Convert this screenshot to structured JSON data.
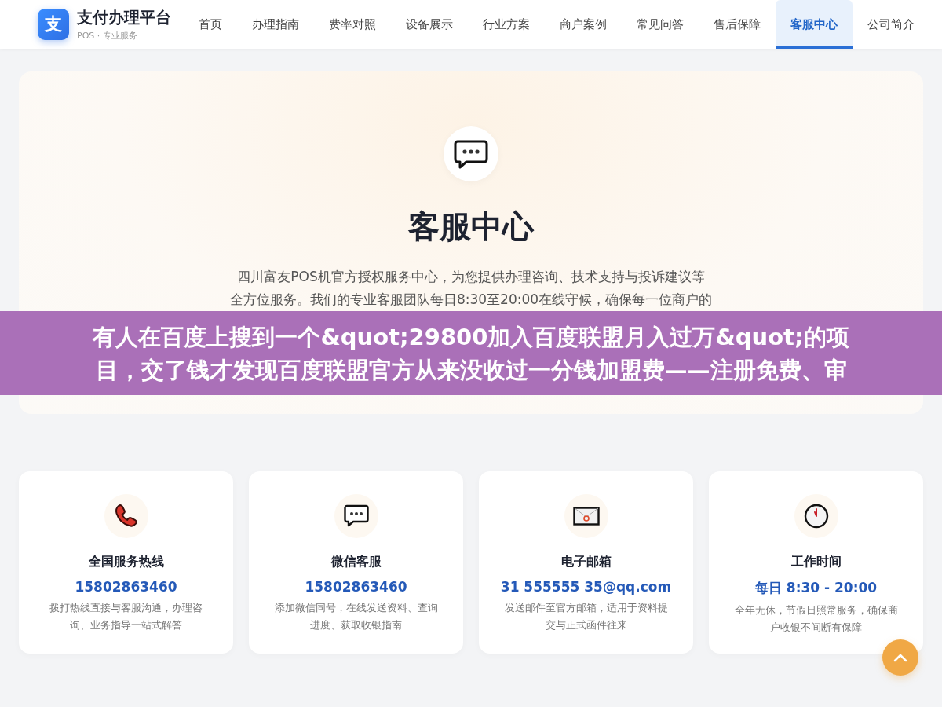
{
  "header": {
    "logo_mark": "支",
    "title": "支付办理平台",
    "subtitle": "POS · 专业服务"
  },
  "nav": [
    {
      "label": "首页",
      "selected": false
    },
    {
      "label": "办理指南",
      "selected": false
    },
    {
      "label": "费率对照",
      "selected": false
    },
    {
      "label": "设备展示",
      "selected": false
    },
    {
      "label": "行业方案",
      "selected": false
    },
    {
      "label": "商户案例",
      "selected": false
    },
    {
      "label": "常见问答",
      "selected": false
    },
    {
      "label": "售后保障",
      "selected": false
    },
    {
      "label": "客服中心",
      "selected": true
    },
    {
      "label": "公司简介",
      "selected": false
    }
  ],
  "hero": {
    "title": "客服中心",
    "description_lines": [
      "四川富友POS机官方授权服务中心，为您提供办理咨询、技术支持与投诉建议等",
      "全方位服务。我们的专业客服团队每日8:30至20:00在线守候，确保每一位商户的"
    ]
  },
  "cards": [
    {
      "kind": "phone",
      "title": "全国服务热线",
      "value": "15802863460",
      "description": "拨打热线直接与客服沟通，办理咨询、业务指导一站式解答"
    },
    {
      "kind": "chat",
      "title": "微信客服",
      "value": "15802863460",
      "description": "添加微信同号，在线发送资料、查询进度、获取收银指南"
    },
    {
      "kind": "mail",
      "title": "电子邮箱",
      "value": "31 555555 35@qq.com",
      "description": "发送邮件至官方邮箱，适用于资料提交与正式函件往来"
    },
    {
      "kind": "clock",
      "title": "工作时间",
      "value": "每日 8:30 - 20:00",
      "description": "全年无休，节假日照常服务，确保商户收银不间断有保障"
    }
  ],
  "banner": {
    "lines": [
      "有人在百度上搜到一个&quot;29800加入百度联盟月入过万&quot;的项",
      "目，交了钱才发现百度联盟官方从来没收过一分钱加盟费——注册免费、审"
    ]
  }
}
